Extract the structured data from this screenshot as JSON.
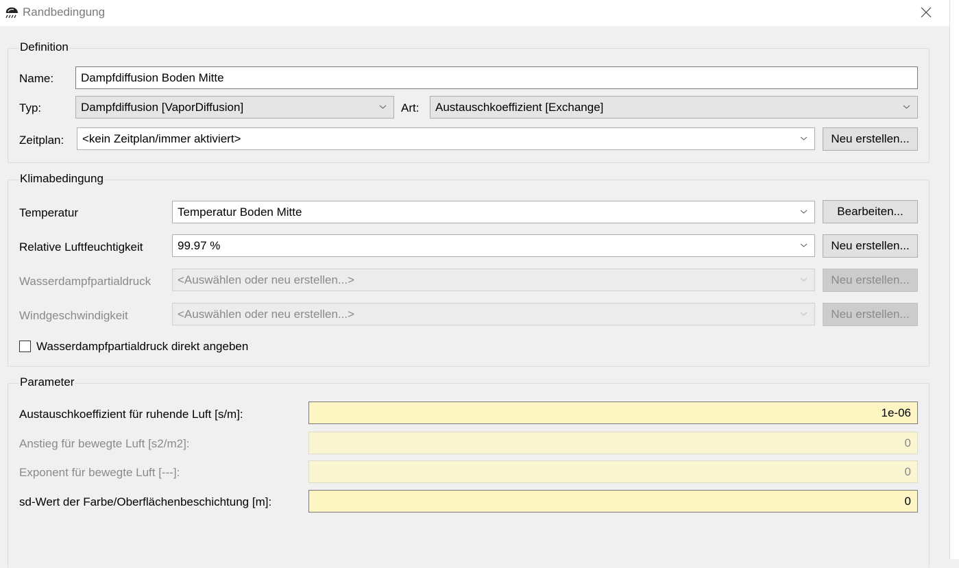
{
  "window": {
    "title": "Randbedingung",
    "app_icon": "rain-cloud-icon",
    "close_icon": "close-icon"
  },
  "definition": {
    "group_title": "Definition",
    "name_label": "Name:",
    "name_value": "Dampfdiffusion Boden Mitte",
    "type_label": "Typ:",
    "type_value": "Dampfdiffusion [VaporDiffusion]",
    "kind_label": "Art:",
    "kind_value": "Austauschkoeffizient [Exchange]",
    "schedule_label": "Zeitplan:",
    "schedule_value": "<kein Zeitplan/immer aktiviert>",
    "schedule_button": "Neu erstellen..."
  },
  "climate": {
    "group_title": "Klimabedingung",
    "rows": [
      {
        "label": "Temperatur",
        "value": "Temperatur Boden Mitte",
        "button": "Bearbeiten...",
        "enabled": true
      },
      {
        "label": "Relative Luftfeuchtigkeit",
        "value": "99.97 %",
        "button": "Neu erstellen...",
        "enabled": true
      },
      {
        "label": "Wasserdampfpartialdruck",
        "value": "<Auswählen oder neu erstellen...>",
        "button": "Neu erstellen...",
        "enabled": false
      },
      {
        "label": "Windgeschwindigkeit",
        "value": "<Auswählen oder neu erstellen...>",
        "button": "Neu erstellen...",
        "enabled": false
      }
    ],
    "checkbox_label": "Wasserdampfpartialdruck direkt angeben",
    "checkbox_checked": false
  },
  "parameters": {
    "group_title": "Parameter",
    "rows": [
      {
        "label": "Austauschkoeffizient für ruhende Luft [s/m]:",
        "value": "1e-06",
        "enabled": true
      },
      {
        "label": "Anstieg für bewegte Luft [s2/m2]:",
        "value": "0",
        "enabled": false
      },
      {
        "label": "Exponent für bewegte Luft [---]:",
        "value": "0",
        "enabled": false
      },
      {
        "label": "sd-Wert der Farbe/Oberflächenbeschichtung [m]:",
        "value": "0",
        "enabled": true
      }
    ]
  },
  "colors": {
    "param_field_bg": "#fdf6c3",
    "window_bg": "#f0f0f0",
    "disabled_text": "#8a8a8a"
  }
}
